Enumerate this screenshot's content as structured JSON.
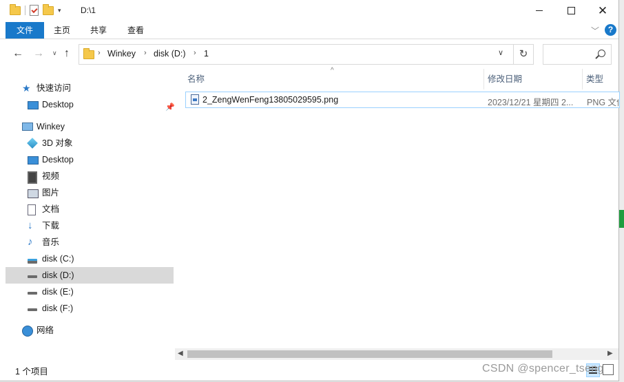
{
  "window": {
    "title": "D:\\1"
  },
  "ribbon": {
    "tabs": [
      "文件",
      "主页",
      "共享",
      "查看"
    ]
  },
  "address": {
    "crumbs": [
      "Winkey",
      "disk (D:)",
      "1"
    ],
    "search_placeholder": ""
  },
  "sidebar": {
    "items": [
      {
        "label": "快速访问"
      },
      {
        "label": "Desktop"
      },
      {
        "label": "Winkey"
      },
      {
        "label": "3D 对象"
      },
      {
        "label": "Desktop"
      },
      {
        "label": "视频"
      },
      {
        "label": "图片"
      },
      {
        "label": "文档"
      },
      {
        "label": "下载"
      },
      {
        "label": "音乐"
      },
      {
        "label": "disk (C:)"
      },
      {
        "label": "disk (D:)"
      },
      {
        "label": "disk (E:)"
      },
      {
        "label": "disk (F:)"
      },
      {
        "label": "网络"
      }
    ]
  },
  "columns": {
    "name": "名称",
    "date": "修改日期",
    "type": "类型"
  },
  "files": [
    {
      "name": "2_ZengWenFeng13805029595.png",
      "date": "2023/12/21 星期四 2...",
      "type": "PNG 文件"
    }
  ],
  "status": {
    "count": "1 个项目"
  },
  "watermark": "CSDN @spencer_tseng"
}
